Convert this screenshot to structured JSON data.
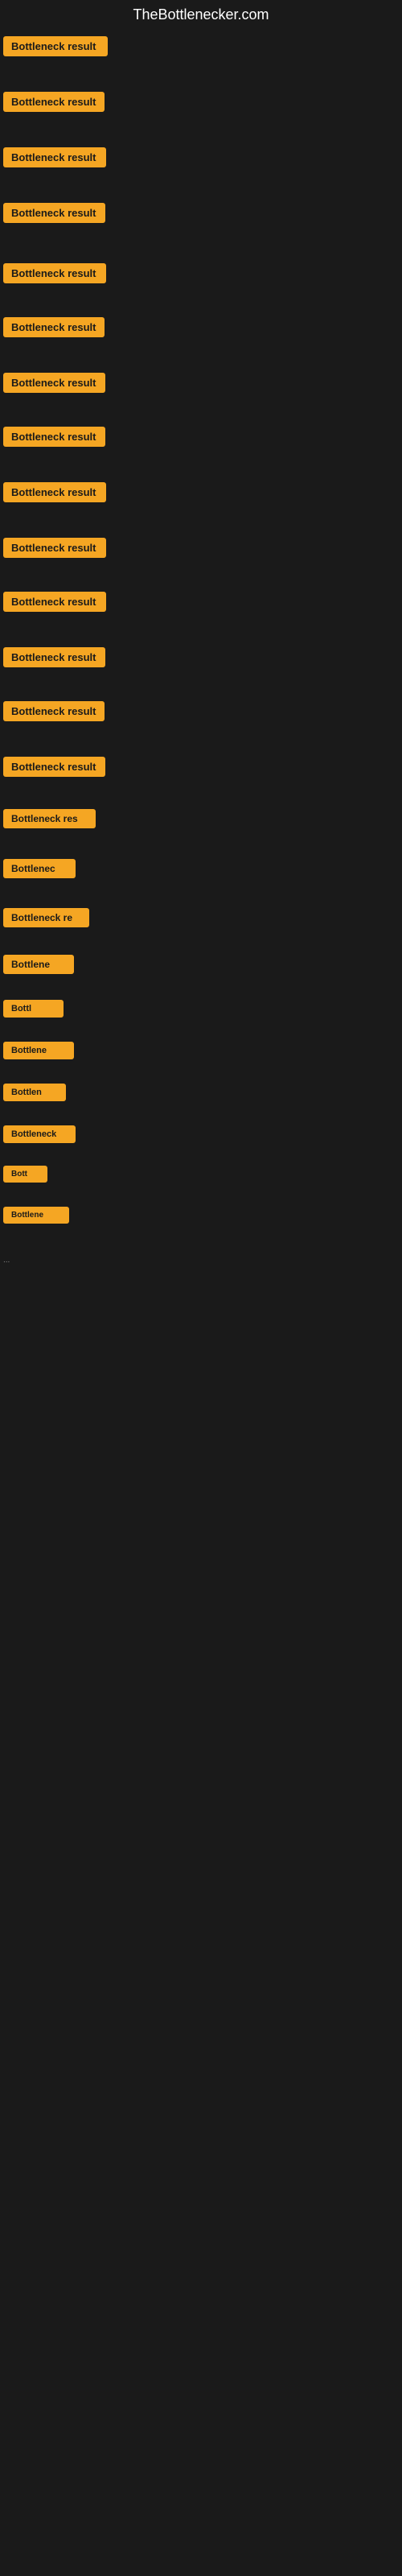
{
  "header": {
    "title": "TheBottlenecker.com"
  },
  "items": [
    {
      "id": 1,
      "label": "Bottleneck result",
      "class": "item-1"
    },
    {
      "id": 2,
      "label": "Bottleneck result",
      "class": "item-2"
    },
    {
      "id": 3,
      "label": "Bottleneck result",
      "class": "item-3"
    },
    {
      "id": 4,
      "label": "Bottleneck result",
      "class": "item-4"
    },
    {
      "id": 5,
      "label": "Bottleneck result",
      "class": "item-5"
    },
    {
      "id": 6,
      "label": "Bottleneck result",
      "class": "item-6"
    },
    {
      "id": 7,
      "label": "Bottleneck result",
      "class": "item-7"
    },
    {
      "id": 8,
      "label": "Bottleneck result",
      "class": "item-8"
    },
    {
      "id": 9,
      "label": "Bottleneck result",
      "class": "item-9"
    },
    {
      "id": 10,
      "label": "Bottleneck result",
      "class": "item-10"
    },
    {
      "id": 11,
      "label": "Bottleneck result",
      "class": "item-11"
    },
    {
      "id": 12,
      "label": "Bottleneck result",
      "class": "item-12"
    },
    {
      "id": 13,
      "label": "Bottleneck result",
      "class": "item-13"
    },
    {
      "id": 14,
      "label": "Bottleneck result",
      "class": "item-14"
    },
    {
      "id": 15,
      "label": "Bottleneck res",
      "class": "item-15"
    },
    {
      "id": 16,
      "label": "Bottlenec",
      "class": "item-16"
    },
    {
      "id": 17,
      "label": "Bottleneck re",
      "class": "item-17"
    },
    {
      "id": 18,
      "label": "Bottlene",
      "class": "item-18"
    },
    {
      "id": 19,
      "label": "Bottl",
      "class": "item-19"
    },
    {
      "id": 20,
      "label": "Bottlene",
      "class": "item-20"
    },
    {
      "id": 21,
      "label": "Bottlen",
      "class": "item-21"
    },
    {
      "id": 22,
      "label": "Bottleneck",
      "class": "item-22"
    },
    {
      "id": 23,
      "label": "Bott",
      "class": "item-23"
    },
    {
      "id": 24,
      "label": "Bottlene",
      "class": "item-24"
    }
  ],
  "dots": "...",
  "colors": {
    "badge_bg": "#f5a623",
    "page_bg": "#1a1a1a",
    "header_text": "#ffffff"
  }
}
